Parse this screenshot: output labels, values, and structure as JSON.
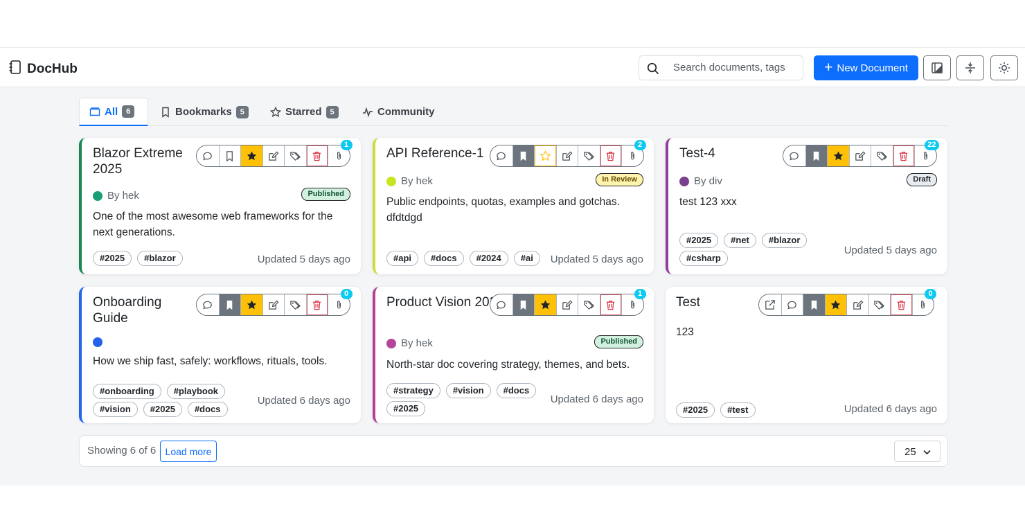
{
  "header": {
    "app_name": "DocHub",
    "search_placeholder": "Search documents, tags",
    "new_document_label": "New Document"
  },
  "tabs": [
    {
      "label": "All",
      "count": "6",
      "active": true
    },
    {
      "label": "Bookmarks",
      "count": "5"
    },
    {
      "label": "Starred",
      "count": "5"
    },
    {
      "label": "Community"
    }
  ],
  "cards": [
    {
      "title": "Blazor Extreme 2025",
      "author": "By hek",
      "author_color": "#1a9e77",
      "border_color": "#198754",
      "status": "Published",
      "description": "One of the most awesome web frameworks for the next generations.",
      "tags": [
        "#2025",
        "#blazor"
      ],
      "updated": "Updated 5 days ago",
      "attachments": "1",
      "bookmarked": false,
      "starred": true
    },
    {
      "title": "API Reference-1",
      "author": "By hek",
      "author_color": "#c9e521",
      "border_color": "#cddc39",
      "status": "In Review",
      "description": "Public endpoints, quotas, examples and gotchas. dfdtdgd",
      "tags": [
        "#api",
        "#docs",
        "#2024",
        "#ai"
      ],
      "updated": "Updated 5 days ago",
      "attachments": "2",
      "bookmarked": true,
      "starred": false
    },
    {
      "title": "Test-4",
      "author": "By div",
      "author_color": "#7b3f8c",
      "border_color": "#8e3e9b",
      "status": "Draft",
      "description": "test 123 xxx",
      "tags": [
        "#2025",
        "#net",
        "#blazor",
        "#csharp"
      ],
      "updated": "Updated 5 days ago",
      "attachments": "22",
      "bookmarked": true,
      "starred": true
    },
    {
      "title": "Onboarding Guide",
      "author": "",
      "author_color": "#2563eb",
      "border_color": "#2563eb",
      "status": "",
      "description": "How we ship fast, safely: workflows, rituals, tools.",
      "tags": [
        "#onboarding",
        "#playbook",
        "#vision",
        "#2025",
        "#docs"
      ],
      "updated": "Updated 6 days ago",
      "attachments": "0",
      "bookmarked": true,
      "starred": true
    },
    {
      "title": "Product Vision 2025",
      "author": "By hek",
      "author_color": "#b5459a",
      "border_color": "#b23f97",
      "status": "Published",
      "description": "North-star doc covering strategy, themes, and bets.",
      "tags": [
        "#strategy",
        "#vision",
        "#docs",
        "#2025"
      ],
      "updated": "Updated 6 days ago",
      "attachments": "1",
      "bookmarked": true,
      "starred": true
    },
    {
      "title": "Test",
      "author": "",
      "author_color": "",
      "border_color": "",
      "status": "",
      "description": "123",
      "tags": [
        "#2025",
        "#test"
      ],
      "updated": "Updated 6 days ago",
      "attachments": "0",
      "bookmarked": true,
      "starred": true
    }
  ],
  "footer": {
    "showing_text": "Showing 6 of 6",
    "load_more_label": "Load more",
    "page_size": "25"
  },
  "status_colors": {
    "Published": {
      "bg": "#d1f0df",
      "fg": "#0f5132"
    },
    "In Review": {
      "bg": "#fff3b0",
      "fg": "#664d03"
    },
    "Draft": {
      "bg": "#e9ecef",
      "fg": "#212529"
    }
  }
}
